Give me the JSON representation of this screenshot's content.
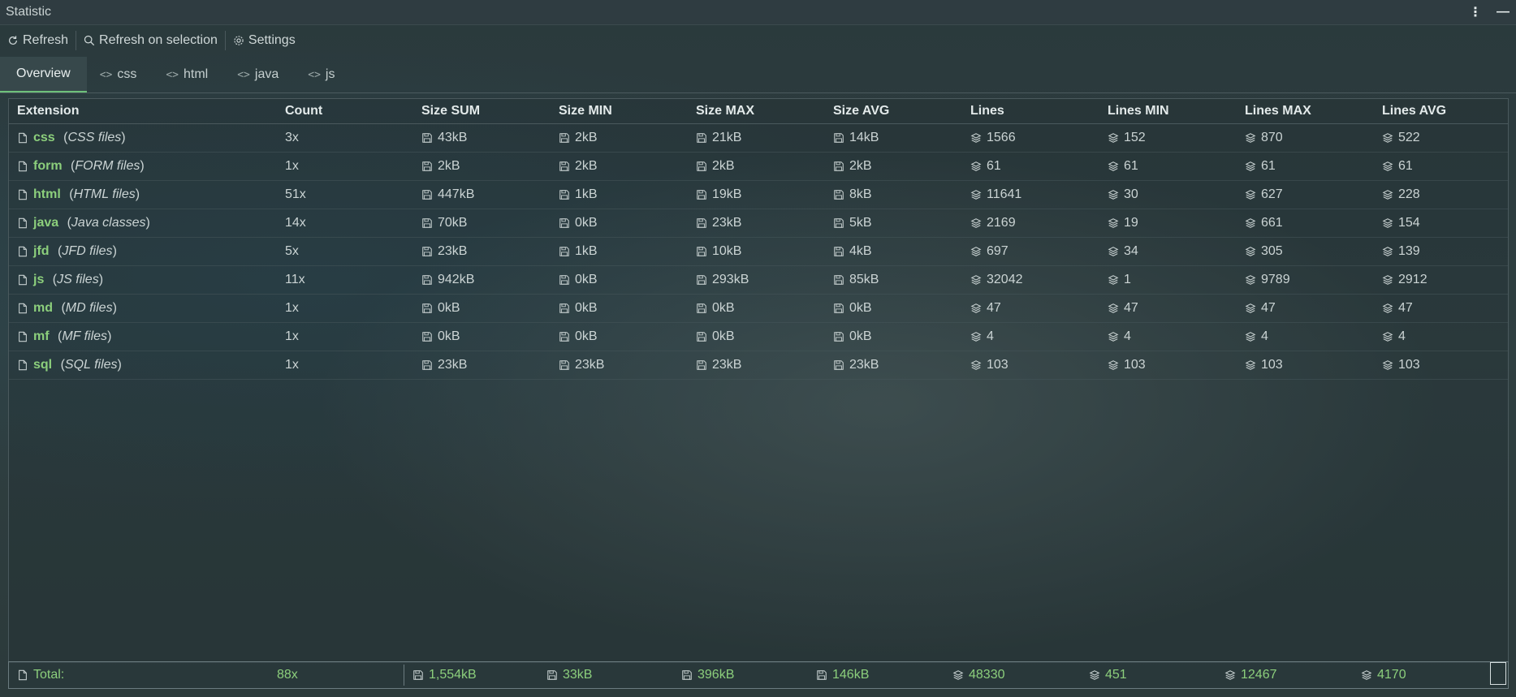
{
  "window": {
    "title": "Statistic"
  },
  "toolbar": {
    "refresh": "Refresh",
    "refresh_selection": "Refresh on selection",
    "settings": "Settings"
  },
  "tabs": [
    {
      "label": "Overview",
      "active": true
    },
    {
      "label": "css"
    },
    {
      "label": "html"
    },
    {
      "label": "java"
    },
    {
      "label": "js"
    }
  ],
  "columns": [
    "Extension",
    "Count",
    "Size SUM",
    "Size MIN",
    "Size MAX",
    "Size AVG",
    "Lines",
    "Lines MIN",
    "Lines MAX",
    "Lines AVG"
  ],
  "rows": [
    {
      "ext": "css",
      "desc": "CSS files",
      "count": "3x",
      "size_sum": "43kB",
      "size_min": "2kB",
      "size_max": "21kB",
      "size_avg": "14kB",
      "lines": "1566",
      "lines_min": "152",
      "lines_max": "870",
      "lines_avg": "522"
    },
    {
      "ext": "form",
      "desc": "FORM files",
      "count": "1x",
      "size_sum": "2kB",
      "size_min": "2kB",
      "size_max": "2kB",
      "size_avg": "2kB",
      "lines": "61",
      "lines_min": "61",
      "lines_max": "61",
      "lines_avg": "61"
    },
    {
      "ext": "html",
      "desc": "HTML files",
      "count": "51x",
      "size_sum": "447kB",
      "size_min": "1kB",
      "size_max": "19kB",
      "size_avg": "8kB",
      "lines": "11641",
      "lines_min": "30",
      "lines_max": "627",
      "lines_avg": "228"
    },
    {
      "ext": "java",
      "desc": "Java classes",
      "count": "14x",
      "size_sum": "70kB",
      "size_min": "0kB",
      "size_max": "23kB",
      "size_avg": "5kB",
      "lines": "2169",
      "lines_min": "19",
      "lines_max": "661",
      "lines_avg": "154"
    },
    {
      "ext": "jfd",
      "desc": "JFD files",
      "count": "5x",
      "size_sum": "23kB",
      "size_min": "1kB",
      "size_max": "10kB",
      "size_avg": "4kB",
      "lines": "697",
      "lines_min": "34",
      "lines_max": "305",
      "lines_avg": "139"
    },
    {
      "ext": "js",
      "desc": "JS files",
      "count": "11x",
      "size_sum": "942kB",
      "size_min": "0kB",
      "size_max": "293kB",
      "size_avg": "85kB",
      "lines": "32042",
      "lines_min": "1",
      "lines_max": "9789",
      "lines_avg": "2912"
    },
    {
      "ext": "md",
      "desc": "MD files",
      "count": "1x",
      "size_sum": "0kB",
      "size_min": "0kB",
      "size_max": "0kB",
      "size_avg": "0kB",
      "lines": "47",
      "lines_min": "47",
      "lines_max": "47",
      "lines_avg": "47"
    },
    {
      "ext": "mf",
      "desc": "MF files",
      "count": "1x",
      "size_sum": "0kB",
      "size_min": "0kB",
      "size_max": "0kB",
      "size_avg": "0kB",
      "lines": "4",
      "lines_min": "4",
      "lines_max": "4",
      "lines_avg": "4"
    },
    {
      "ext": "sql",
      "desc": "SQL files",
      "count": "1x",
      "size_sum": "23kB",
      "size_min": "23kB",
      "size_max": "23kB",
      "size_avg": "23kB",
      "lines": "103",
      "lines_min": "103",
      "lines_max": "103",
      "lines_avg": "103"
    }
  ],
  "totals": {
    "label": "Total:",
    "count": "88x",
    "size_sum": "1,554kB",
    "size_min": "33kB",
    "size_max": "396kB",
    "size_avg": "146kB",
    "lines": "48330",
    "lines_min": "451",
    "lines_max": "12467",
    "lines_avg": "4170"
  },
  "colors": {
    "accent": "#8ccf7c",
    "tab_underline": "#6ec17a"
  }
}
